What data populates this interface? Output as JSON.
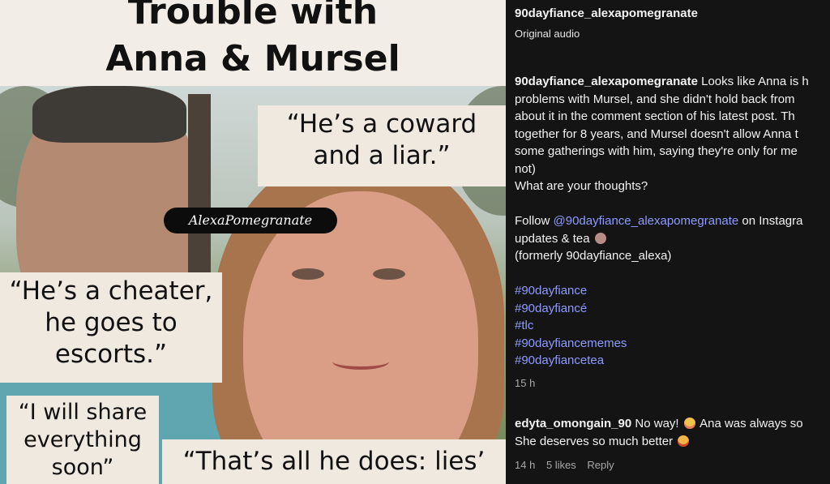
{
  "post_image": {
    "title_lines": [
      "Trouble with",
      "Anna & Mursel"
    ],
    "quote1_lines": [
      "“He’s a coward",
      "and a liar.”"
    ],
    "quote2_lines": [
      "“He’s a cheater,",
      "he goes to",
      "escorts.”"
    ],
    "quote3_lines": [
      "“I will share",
      "everything",
      "soon”"
    ],
    "quote4": "“That’s all he does: lies’",
    "watermark": "AlexaPomegranate"
  },
  "post_header": {
    "author": "90dayfiance_alexapomegranate",
    "subtitle": "Original audio"
  },
  "caption": {
    "author": "90dayfiance_alexapomegranate",
    "lines": [
      "Looks like Anna is h",
      "problems with Mursel, and she didn't hold back from",
      "about it in the comment section of his latest post. Th",
      "together for 8 years, and Mursel doesn't allow Anna t",
      "some gatherings with him, saying they're only for me",
      "not)",
      "What are your thoughts?"
    ],
    "follow_prefix": "Follow ",
    "follow_link": "@90dayfiance_alexapomegranate",
    "follow_suffix": " on Instagra",
    "updates_line": "updates & tea",
    "formerly_line": "(formerly 90dayfiance_alexa)",
    "hashtags": [
      "#90dayfiance",
      "#90dayfiancé",
      "#tlc",
      "#90dayfiancememes",
      "#90dayfiancetea"
    ],
    "time": "15 h",
    "emoji_tea": "tea-cup-emoji"
  },
  "comment": {
    "author": "edyta_omongain_90",
    "text1": "No way!",
    "text2": "Ana was always so",
    "line2": "She deserves so much better",
    "emoji1": "flushed-face-emoji",
    "emoji2": "pleading-face-emoji",
    "time": "14 h",
    "likes": "5 likes",
    "reply": "Reply"
  }
}
